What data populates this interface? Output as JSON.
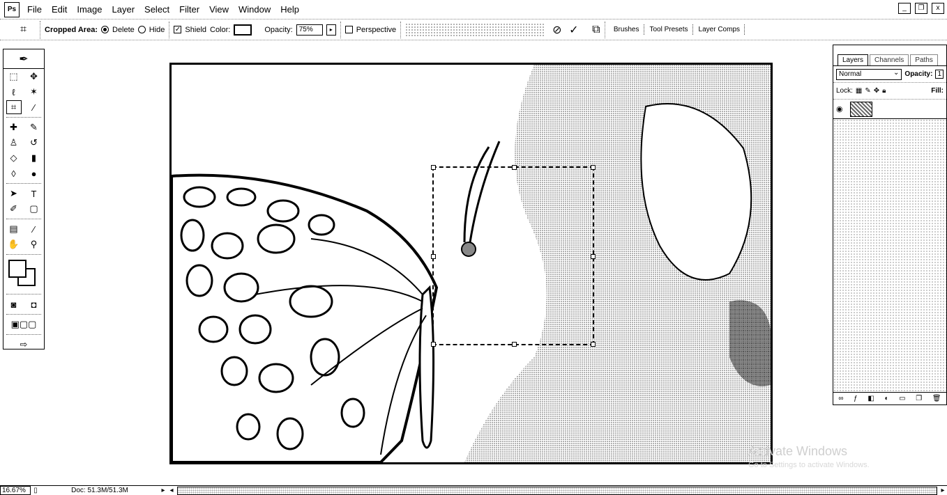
{
  "menu": {
    "app_icon": "Ps",
    "items": [
      "File",
      "Edit",
      "Image",
      "Layer",
      "Select",
      "Filter",
      "View",
      "Window",
      "Help"
    ]
  },
  "window_controls": {
    "minimize": "_",
    "restore": "❐",
    "close": "x"
  },
  "options_bar": {
    "tool_icon": "crop-icon",
    "cropped_area_label": "Cropped Area:",
    "delete_label": "Delete",
    "hide_label": "Hide",
    "selected_mode": "Delete",
    "shield_label": "Shield",
    "shield_checked": true,
    "color_label": "Color:",
    "opacity_label": "Opacity:",
    "opacity_value": "75%",
    "perspective_label": "Perspective",
    "perspective_checked": false,
    "cancel_symbol": "⊘",
    "commit_symbol": "✓",
    "palette_well_tabs": [
      "Brushes",
      "Tool Presets",
      "Layer Comps"
    ]
  },
  "toolbox": {
    "tools": [
      [
        "marquee-icon",
        "move-icon"
      ],
      [
        "lasso-icon",
        "magic-wand-icon"
      ],
      [
        "crop-icon",
        "slice-icon"
      ],
      [
        "healing-brush-icon",
        "brush-icon"
      ],
      [
        "clone-stamp-icon",
        "history-brush-icon"
      ],
      [
        "eraser-icon",
        "gradient-icon"
      ],
      [
        "blur-icon",
        "dodge-icon"
      ],
      [
        "path-select-icon",
        "type-icon"
      ],
      [
        "pen-icon",
        "shape-icon"
      ],
      [
        "notes-icon",
        "eyedropper-icon"
      ],
      [
        "hand-icon",
        "zoom-icon"
      ]
    ],
    "active_tool": "crop-icon"
  },
  "layers_panel": {
    "tabs": [
      "Layers",
      "Channels",
      "Paths"
    ],
    "active_tab": "Layers",
    "blend_mode": "Normal",
    "opacity_label": "Opacity:",
    "opacity_value": "1",
    "lock_label": "Lock:",
    "fill_label": "Fill:"
  },
  "watermark": {
    "title": "Activate Windows",
    "subtitle": "Go to Settings to activate Windows."
  },
  "status_bar": {
    "zoom": "16.67%",
    "doc_size": "Doc: 51.3M/51.3M"
  }
}
